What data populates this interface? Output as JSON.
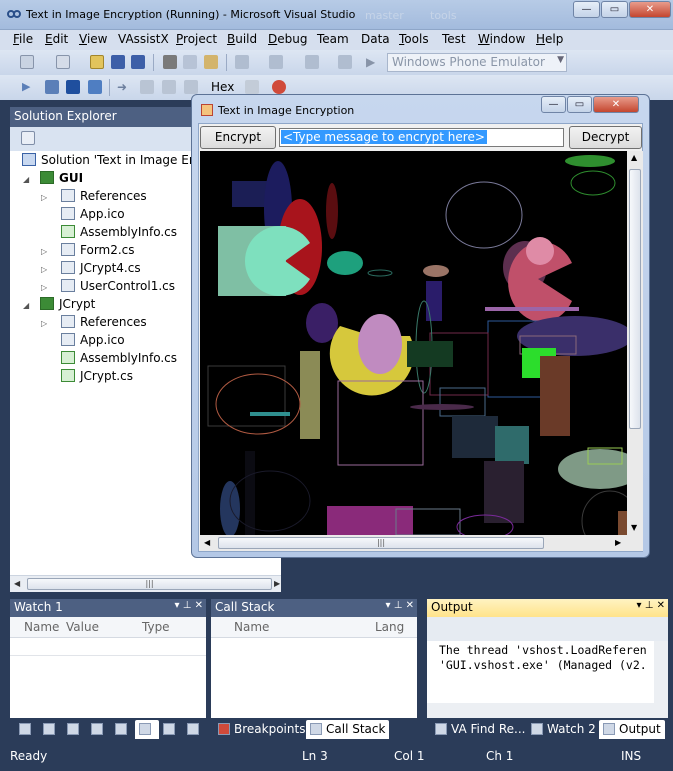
{
  "window": {
    "title": "Text in Image Encryption (Running) - Microsoft Visual Studio",
    "ghost_text_1": "master",
    "ghost_text_2": "tools",
    "minimize": "—",
    "maximize": "▭",
    "close": "✕"
  },
  "menu": {
    "items": [
      {
        "label": "File",
        "ul": "F",
        "rest": "ile"
      },
      {
        "label": "Edit",
        "ul": "E",
        "rest": "dit"
      },
      {
        "label": "View",
        "ul": "V",
        "rest": "iew"
      },
      {
        "label": "VAssistX",
        "ul": "",
        "rest": "VAssistX"
      },
      {
        "label": "Project",
        "ul": "P",
        "rest": "roject"
      },
      {
        "label": "Build",
        "ul": "B",
        "rest": "uild"
      },
      {
        "label": "Debug",
        "ul": "D",
        "rest": "ebug"
      },
      {
        "label": "Team",
        "ul": "",
        "rest": "Team"
      },
      {
        "label": "Data",
        "ul": "",
        "rest": "Data"
      },
      {
        "label": "Tools",
        "ul": "T",
        "rest": "ools"
      },
      {
        "label": "Test",
        "ul": "",
        "rest": "Test"
      },
      {
        "label": "Window",
        "ul": "W",
        "rest": "indow"
      },
      {
        "label": "Help",
        "ul": "H",
        "rest": "elp"
      }
    ]
  },
  "toolbar": {
    "target_combo": "Windows Phone Emulator",
    "hex_label": "Hex"
  },
  "solution_explorer": {
    "title": "Solution Explorer",
    "items": [
      {
        "label": "Solution 'Text in Image Encr",
        "icon": "solution-icon"
      },
      {
        "label": "GUI",
        "icon": "csharp-project-icon"
      },
      {
        "label": "References",
        "icon": "references-icon"
      },
      {
        "label": "App.ico",
        "icon": "icon-file-icon"
      },
      {
        "label": "AssemblyInfo.cs",
        "icon": "cs-file-icon"
      },
      {
        "label": "Form2.cs",
        "icon": "form-file-icon"
      },
      {
        "label": "JCrypt4.cs",
        "icon": "form-file-icon"
      },
      {
        "label": "UserControl1.cs",
        "icon": "usercontrol-file-icon"
      },
      {
        "label": "JCrypt",
        "icon": "csharp-project-icon"
      },
      {
        "label": "References",
        "icon": "references-icon"
      },
      {
        "label": "App.ico",
        "icon": "icon-file-icon"
      },
      {
        "label": "AssemblyInfo.cs",
        "icon": "cs-file-icon"
      },
      {
        "label": "JCrypt.cs",
        "icon": "cs-file-icon"
      }
    ]
  },
  "watch": {
    "title": "Watch 1",
    "columns": [
      "Name",
      "Value",
      "Type"
    ]
  },
  "callstack": {
    "title": "Call Stack",
    "columns": [
      "Name",
      "Lang"
    ]
  },
  "output": {
    "title": "Output",
    "lines": [
      "The thread 'vshost.LoadReferen",
      "'GUI.vshost.exe' (Managed (v2."
    ]
  },
  "bottom_tabs_left": {
    "breakpoints": "Breakpoints",
    "callstack": "Call Stack"
  },
  "bottom_tabs_right": {
    "find": "VA Find Re...",
    "watch2": "Watch 2",
    "output": "Output"
  },
  "status": {
    "ready": "Ready",
    "ln": "Ln 3",
    "col": "Col 1",
    "ch": "Ch 1",
    "mode": "INS"
  },
  "form": {
    "title": "Text in Image Encryption",
    "encrypt_label": "Encrypt",
    "decrypt_label": "Decrypt",
    "message_text": "<Type message to encrypt here>"
  }
}
